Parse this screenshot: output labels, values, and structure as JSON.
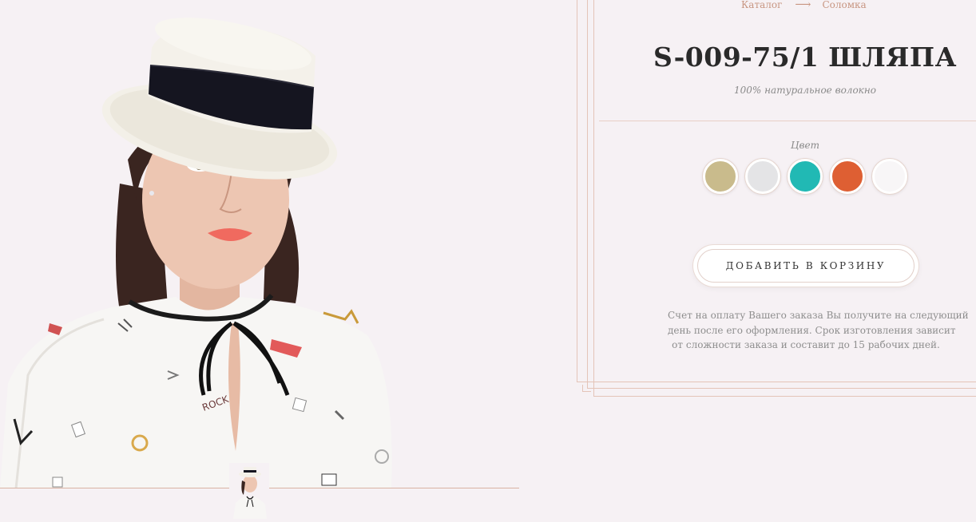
{
  "breadcrumb": {
    "items": [
      "Каталог",
      "Соломка"
    ],
    "separator": "⟶"
  },
  "product": {
    "title": "S-009-75/1 ШЛЯПА",
    "composition": "100% натуральное волокно",
    "photo_description": "model wearing a white straw boater hat with black band"
  },
  "colors": {
    "label": "Цвет",
    "swatches": [
      {
        "name": "beige",
        "hex": "#c9bb8c"
      },
      {
        "name": "light-grey",
        "hex": "#e4e4e6"
      },
      {
        "name": "turquoise",
        "hex": "#21b9b4"
      },
      {
        "name": "orange",
        "hex": "#de5f33"
      },
      {
        "name": "white",
        "hex": "#f8f6f7"
      }
    ]
  },
  "cart": {
    "button_label": "ДОБАВИТЬ В КОРЗИНУ"
  },
  "note": {
    "lines": [
      "Счет на оплату Вашего заказа Вы получите на следующий",
      "день после его оформления. Срок изготовления зависит",
      "от сложности заказа и составит до 15 рабочих дней."
    ]
  },
  "theme": {
    "background": "#f6f1f4",
    "accent": "#c89682",
    "line": "#e4c4b8"
  }
}
